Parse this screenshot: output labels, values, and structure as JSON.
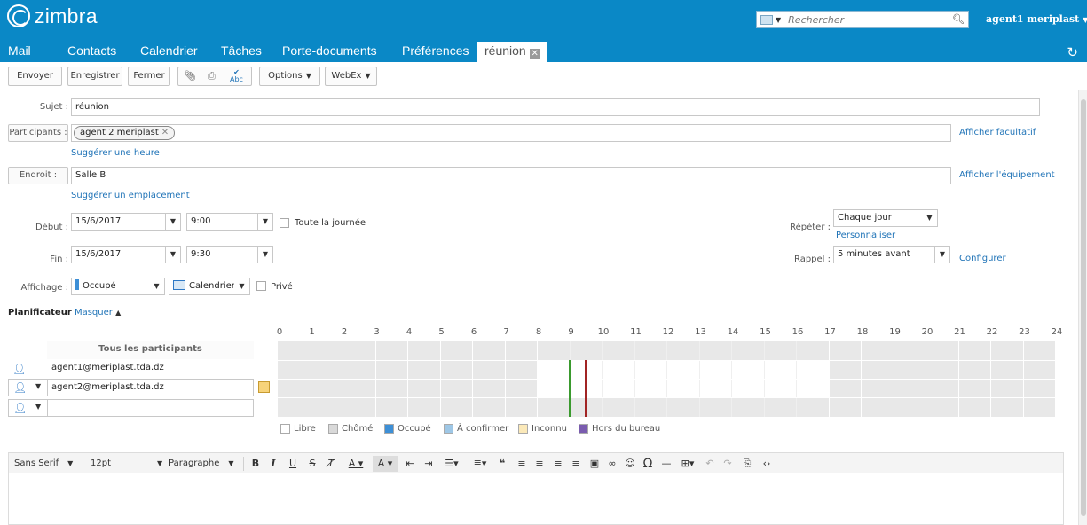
{
  "header": {
    "logo_text": "zimbra",
    "search_placeholder": "Rechercher",
    "user_label": "agent1 meriplast",
    "tabs": [
      "Mail",
      "Contacts",
      "Calendrier",
      "Tâches",
      "Porte-documents",
      "Préférences",
      "réunion"
    ]
  },
  "toolbar": {
    "send": "Envoyer",
    "save": "Enregistrer",
    "close": "Fermer",
    "options": "Options",
    "webex": "WebEx"
  },
  "form": {
    "subject_label": "Sujet :",
    "subject_value": "réunion",
    "participants_label": "Participants :",
    "participant_chip": "agent 2 meriplast",
    "show_optional": "Afficher facultatif",
    "suggest_time": "Suggérer une heure",
    "location_label": "Endroit :",
    "location_value": "Salle B",
    "show_equipment": "Afficher l'équipement",
    "suggest_location": "Suggérer un emplacement",
    "start_label": "Début :",
    "start_date": "15/6/2017",
    "start_time": "9:00",
    "all_day": "Toute la journée",
    "end_label": "Fin :",
    "end_date": "15/6/2017",
    "end_time": "9:30",
    "repeat_label": "Répéter :",
    "repeat_value": "Chaque jour",
    "customize": "Personnaliser",
    "reminder_label": "Rappel :",
    "reminder_value": "5 minutes avant",
    "configure": "Configurer",
    "display_label": "Affichage :",
    "display_value": "Occupé",
    "calendar_value": "Calendrier",
    "private": "Privé"
  },
  "scheduler": {
    "title": "Planificateur",
    "hide": "Masquer",
    "hours": [
      "0",
      "1",
      "2",
      "3",
      "4",
      "5",
      "6",
      "7",
      "8",
      "9",
      "10",
      "11",
      "12",
      "13",
      "14",
      "15",
      "16",
      "17",
      "18",
      "19",
      "20",
      "21",
      "22",
      "23",
      "24"
    ],
    "all_participants": "Tous les participants",
    "attendees": [
      "agent1@meriplast.tda.dz",
      "agent2@meriplast.tda.dz",
      ""
    ],
    "legend": [
      {
        "label": "Libre",
        "color": "#ffffff"
      },
      {
        "label": "Chômé",
        "color": "#d9d9d9"
      },
      {
        "label": "Occupé",
        "color": "#3d8fd6"
      },
      {
        "label": "À confirmer",
        "color": "#9ec7e6"
      },
      {
        "label": "Inconnu",
        "color": "#fbe9b9"
      },
      {
        "label": "Hors du bureau",
        "color": "#7a5caf"
      }
    ],
    "start_line_color": "#3a9a2e",
    "end_line_color": "#a12424"
  },
  "editor": {
    "font_family": "Sans Serif",
    "font_size": "12pt",
    "block_format": "Paragraphe"
  },
  "colors": {
    "header_bg": "#0a88c6",
    "link": "#1f73b7"
  }
}
